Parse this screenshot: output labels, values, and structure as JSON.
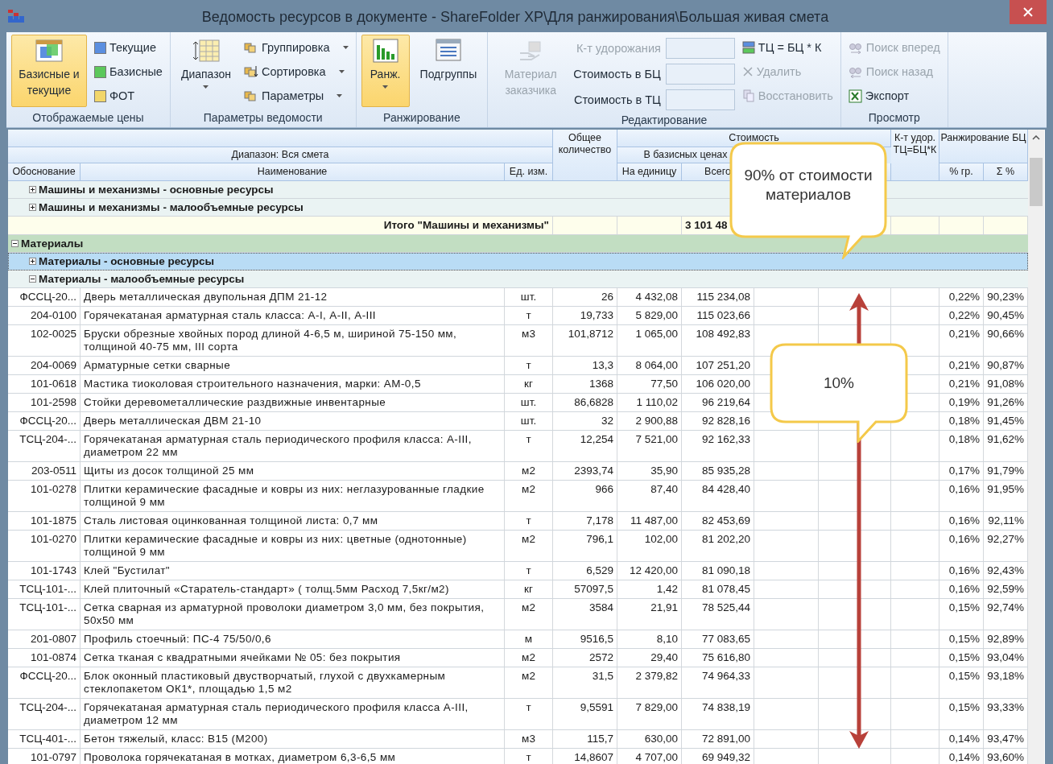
{
  "window": {
    "title": "Ведомость ресурсов в документе - ShareFolder XP\\Для ранжирования\\Большая живая смета"
  },
  "ribbon": {
    "groups": [
      {
        "label": "Отображаемые цены",
        "items": [
          {
            "kind": "large",
            "label": "Базисные и текущие",
            "selected": true,
            "disabled": false
          },
          {
            "kind": "small",
            "label": "Текущие",
            "color": "#5b8fe0",
            "disabled": false
          },
          {
            "kind": "small",
            "label": "Базисные",
            "color": "#5cc85c",
            "disabled": false
          },
          {
            "kind": "small",
            "label": "ФОТ",
            "color": "#f2d66a",
            "disabled": false
          }
        ]
      },
      {
        "label": "Параметры ведомости",
        "items": [
          {
            "kind": "large",
            "label": "Диапазон",
            "selected": false,
            "disabled": false,
            "dropdown": true
          },
          {
            "kind": "small",
            "label": "Группировка",
            "disabled": false,
            "dropdown": true
          },
          {
            "kind": "small",
            "label": "Сортировка",
            "disabled": false,
            "dropdown": true
          },
          {
            "kind": "small",
            "label": "Параметры",
            "disabled": false,
            "dropdown": true
          }
        ]
      },
      {
        "label": "Ранжирование",
        "items": [
          {
            "kind": "large",
            "label": "Ранж.",
            "selected": true,
            "disabled": false,
            "dropdown": true
          },
          {
            "kind": "large",
            "label": "Подгруппы",
            "selected": false,
            "disabled": false
          }
        ]
      },
      {
        "label": "Редактирование",
        "items": [
          {
            "kind": "large",
            "label": "Материал заказчика",
            "selected": false,
            "disabled": true
          },
          {
            "kind": "field",
            "label": "К-т удорожания",
            "disabled": true
          },
          {
            "kind": "field",
            "label": "Стоимость в БЦ",
            "disabled": false
          },
          {
            "kind": "field",
            "label": "Стоимость в ТЦ",
            "disabled": false
          },
          {
            "kind": "small",
            "label": "ТЦ = БЦ * К",
            "disabled": false
          },
          {
            "kind": "small",
            "label": "Удалить",
            "disabled": true
          },
          {
            "kind": "small",
            "label": "Восстановить",
            "disabled": true
          }
        ]
      },
      {
        "label": "Просмотр",
        "items": [
          {
            "kind": "small",
            "label": "Поиск вперед",
            "disabled": true
          },
          {
            "kind": "small",
            "label": "Поиск назад",
            "disabled": true
          },
          {
            "kind": "small",
            "label": "Экспорт",
            "disabled": false
          }
        ]
      }
    ]
  },
  "table": {
    "header": {
      "range": "Диапазон: Вся смета",
      "code": "Обоснование",
      "name": "Наименование",
      "unit": "Ед. изм.",
      "quantity": "Общее количество",
      "cost": "Стоимость",
      "base": "В базисных ценах",
      "unit_price": "На единицу",
      "total": "Всего",
      "coef": "К-т удор. ТЦ=БЦ*К",
      "ranking": "Ранжирование БЦ",
      "share": "% гр.",
      "cumulative": "Σ %"
    },
    "rows": [
      {
        "kind": "group",
        "label": "Машины и механизмы - основные ресурсы",
        "expanded": false,
        "selected": false
      },
      {
        "kind": "group",
        "label": "Машины и механизмы - малообъемные ресурсы",
        "expanded": false,
        "selected": false
      },
      {
        "kind": "total",
        "label": "Итого \"Машины и механизмы\"",
        "total": "3 101 48"
      },
      {
        "kind": "category",
        "label": "Материалы",
        "expanded": true,
        "selected": false,
        "children": [
          {
            "kind": "group",
            "label": "Материалы - основные ресурсы",
            "expanded": false,
            "selected": true
          },
          {
            "kind": "group",
            "label": "Материалы - малообъемные ресурсы",
            "expanded": true,
            "selected": false,
            "children": [
              {
                "kind": "item",
                "code": "ФССЦ-20...",
                "name": "Дверь  металлическая  двупольная ДПМ 21-12",
                "unit": "шт.",
                "quantity": "26",
                "unit_price": "4 432,08",
                "total": "115 234,08",
                "share": "0,22%",
                "cumulative": "90,23%"
              },
              {
                "kind": "item",
                "code": "204-0100",
                "name": "Горячекатаная арматурная сталь класса: А-I, А-II, А-III",
                "unit": "т",
                "quantity": "19,733",
                "unit_price": "5 829,00",
                "total": "115 023,66",
                "share": "0,22%",
                "cumulative": "90,45%"
              },
              {
                "kind": "item",
                "code": "102-0025",
                "name": "Бруски обрезные хвойных пород длиной 4-6,5 м, шириной 75-150 мм, толщиной 40-75 мм, III сорта",
                "unit": "м3",
                "quantity": "101,8712",
                "unit_price": "1 065,00",
                "total": "108 492,83",
                "share": "0,21%",
                "cumulative": "90,66%"
              },
              {
                "kind": "item",
                "code": "204-0069",
                "name": "Арматурные сетки сварные",
                "unit": "т",
                "quantity": "13,3",
                "unit_price": "8 064,00",
                "total": "107 251,20",
                "share": "0,21%",
                "cumulative": "90,87%"
              },
              {
                "kind": "item",
                "code": "101-0618",
                "name": "Мастика тиоколовая строительного назначения, марки: АМ-0,5",
                "unit": "кг",
                "quantity": "1368",
                "unit_price": "77,50",
                "total": "106 020,00",
                "share": "0,21%",
                "cumulative": "91,08%"
              },
              {
                "kind": "item",
                "code": "101-2598",
                "name": "Стойки деревометаллические раздвижные инвентарные",
                "unit": "шт.",
                "quantity": "86,6828",
                "unit_price": "1 110,02",
                "total": "96 219,64",
                "share": "0,19%",
                "cumulative": "91,26%"
              },
              {
                "kind": "item",
                "code": "ФССЦ-20...",
                "name": "Дверь  металлическая ДВМ 21-10",
                "unit": "шт.",
                "quantity": "32",
                "unit_price": "2 900,88",
                "total": "92 828,16",
                "share": "0,18%",
                "cumulative": "91,45%"
              },
              {
                "kind": "item",
                "code": "ТСЦ-204-...",
                "name": "Горячекатаная арматурная сталь периодического профиля класса: А-III, диаметром 22 мм",
                "unit": "т",
                "quantity": "12,254",
                "unit_price": "7 521,00",
                "total": "92 162,33",
                "share": "0,18%",
                "cumulative": "91,62%"
              },
              {
                "kind": "item",
                "code": "203-0511",
                "name": "Щиты из досок толщиной 25 мм",
                "unit": "м2",
                "quantity": "2393,74",
                "unit_price": "35,90",
                "total": "85 935,28",
                "share": "0,17%",
                "cumulative": "91,79%"
              },
              {
                "kind": "item",
                "code": "101-0278",
                "name": "Плитки керамические фасадные и ковры из них: неглазурованные гладкие толщиной 9 мм",
                "unit": "м2",
                "quantity": "966",
                "unit_price": "87,40",
                "total": "84 428,40",
                "share": "0,16%",
                "cumulative": "91,95%"
              },
              {
                "kind": "item",
                "code": "101-1875",
                "name": "Сталь листовая оцинкованная толщиной листа: 0,7 мм",
                "unit": "т",
                "quantity": "7,178",
                "unit_price": "11 487,00",
                "total": "82 453,69",
                "share": "0,16%",
                "cumulative": "92,11%"
              },
              {
                "kind": "item",
                "code": "101-0270",
                "name": "Плитки керамические фасадные и ковры из них: цветные (однотонные) толщиной 9 мм",
                "unit": "м2",
                "quantity": "796,1",
                "unit_price": "102,00",
                "total": "81 202,20",
                "share": "0,16%",
                "cumulative": "92,27%"
              },
              {
                "kind": "item",
                "code": "101-1743",
                "name": "Клей \"Бустилат\"",
                "unit": "т",
                "quantity": "6,529",
                "unit_price": "12 420,00",
                "total": "81 090,18",
                "share": "0,16%",
                "cumulative": "92,43%"
              },
              {
                "kind": "item",
                "code": "ТСЦ-101-...",
                "name": "Клей плиточный «Старатель-стандарт»  ( толщ.5мм  Расход 7,5кг/м2)",
                "unit": "кг",
                "quantity": "57097,5",
                "unit_price": "1,42",
                "total": "81 078,45",
                "share": "0,16%",
                "cumulative": "92,59%"
              },
              {
                "kind": "item",
                "code": "ТСЦ-101-...",
                "name": "Сетка сварная из арматурной проволоки диаметром 3,0 мм, без покрытия, 50x50 мм",
                "unit": "м2",
                "quantity": "3584",
                "unit_price": "21,91",
                "total": "78 525,44",
                "share": "0,15%",
                "cumulative": "92,74%"
              },
              {
                "kind": "item",
                "code": "201-0807",
                "name": "Профиль стоечный: ПС-4 75/50/0,6",
                "unit": "м",
                "quantity": "9516,5",
                "unit_price": "8,10",
                "total": "77 083,65",
                "share": "0,15%",
                "cumulative": "92,89%"
              },
              {
                "kind": "item",
                "code": "101-0874",
                "name": "Сетка тканая с квадратными ячейками № 05: без покрытия",
                "unit": "м2",
                "quantity": "2572",
                "unit_price": "29,40",
                "total": "75 616,80",
                "share": "0,15%",
                "cumulative": "93,04%"
              },
              {
                "kind": "item",
                "code": "ФССЦ-20...",
                "name": "Блок оконный пластиковый двустворчатый, глухой с двухкамерным стеклопакетом ОК1*, площадью  1,5 м2",
                "unit": "м2",
                "quantity": "31,5",
                "unit_price": "2 379,82",
                "total": "74 964,33",
                "share": "0,15%",
                "cumulative": "93,18%"
              },
              {
                "kind": "item",
                "code": "ТСЦ-204-...",
                "name": "Горячекатаная арматурная сталь периодического профиля класса А-III, диаметром 12 мм",
                "unit": "т",
                "quantity": "9,5591",
                "unit_price": "7 829,00",
                "total": "74 838,19",
                "share": "0,15%",
                "cumulative": "93,33%"
              },
              {
                "kind": "item",
                "code": "ТСЦ-401-...",
                "name": "Бетон тяжелый, класс: В15 (М200)",
                "unit": "м3",
                "quantity": "115,7",
                "unit_price": "630,00",
                "total": "72 891,00",
                "share": "0,14%",
                "cumulative": "93,47%"
              },
              {
                "kind": "item",
                "code": "101-0797",
                "name": "Проволока горячекатаная в мотках, диаметром 6,3-6,5 мм",
                "unit": "т",
                "quantity": "14,8607",
                "unit_price": "4 707,00",
                "total": "69 949,32",
                "share": "0,14%",
                "cumulative": "93,60%"
              }
            ]
          }
        ]
      }
    ]
  },
  "callouts": [
    {
      "text": "90% от стоимости материалов"
    },
    {
      "text": "10%"
    }
  ]
}
